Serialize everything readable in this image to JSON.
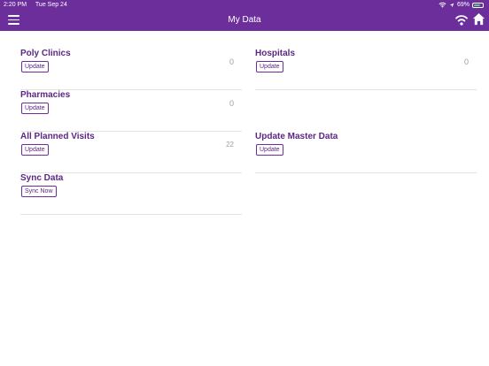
{
  "status": {
    "time": "2:20 PM",
    "date": "Tue Sep 24",
    "battery": "69%"
  },
  "header": {
    "title": "My Data"
  },
  "cards": [
    {
      "title": "Poly Clinics",
      "button": "Update",
      "count": "0"
    },
    {
      "title": "Hospitals",
      "button": "Update",
      "count": "0"
    },
    {
      "title": "Pharmacies",
      "button": "Update",
      "count": "0"
    },
    {
      "title": "All Planned Visits",
      "button": "Update",
      "count": "22"
    },
    {
      "title": "Update Master Data",
      "button": "Update"
    },
    {
      "title": "Sync Data",
      "button": "Sync Now"
    }
  ],
  "colors": {
    "primary": "#6b2e9a",
    "title_text": "#5b2685",
    "count_text": "#9e9e9e",
    "divider": "#e3e3e3"
  },
  "icons": [
    "menu-icon",
    "wifi-icon",
    "home-icon",
    "location-arrow-icon",
    "battery-icon"
  ]
}
